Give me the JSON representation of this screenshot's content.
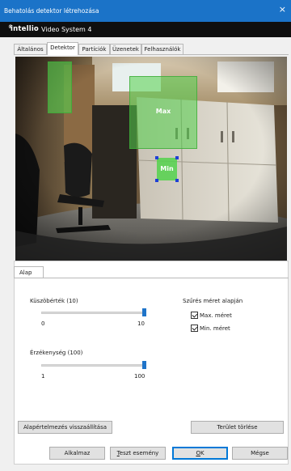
{
  "window": {
    "title": "Behatolás detektor létrehozása",
    "close_glyph": "×"
  },
  "brand": {
    "logo_text": "intellio",
    "logo_mark": "®",
    "product": "Video System 4"
  },
  "tabs": [
    {
      "label": "Általános",
      "active": false
    },
    {
      "label": "Detektor",
      "active": true
    },
    {
      "label": "Partíciók",
      "active": false
    },
    {
      "label": "Üzenetek",
      "active": false
    },
    {
      "label": "Felhasználók",
      "active": false
    }
  ],
  "camera": {
    "max_label": "Max",
    "min_label": "Min",
    "zone_color": "#54d24c",
    "handle_color": "#1f3fd6"
  },
  "settings": {
    "subtab": "Alap",
    "threshold": {
      "label": "Küszöbérték (10)",
      "min": "0",
      "max": "10",
      "value_fraction": 1.0
    },
    "sensitivity": {
      "label": "Érzékenység (100)",
      "min": "1",
      "max": "100",
      "value_fraction": 1.0
    },
    "size_filter": {
      "heading": "Szűrés méret alapján",
      "max_label": "Max. méret",
      "min_label": "Min. méret",
      "max_checked": true,
      "min_checked": true
    },
    "reset_button": "Alapértelmezés visszaállítása",
    "clear_button": "Terület törlése"
  },
  "footer": {
    "apply": "Alkalmaz",
    "test_prefix": "",
    "test_underlined": "T",
    "test_rest": "eszt esemény",
    "ok_underlined": "O",
    "ok_rest": "K",
    "cancel": "Mégse"
  },
  "colors": {
    "titlebar": "#1b73c8",
    "accent": "#1f74c9"
  }
}
